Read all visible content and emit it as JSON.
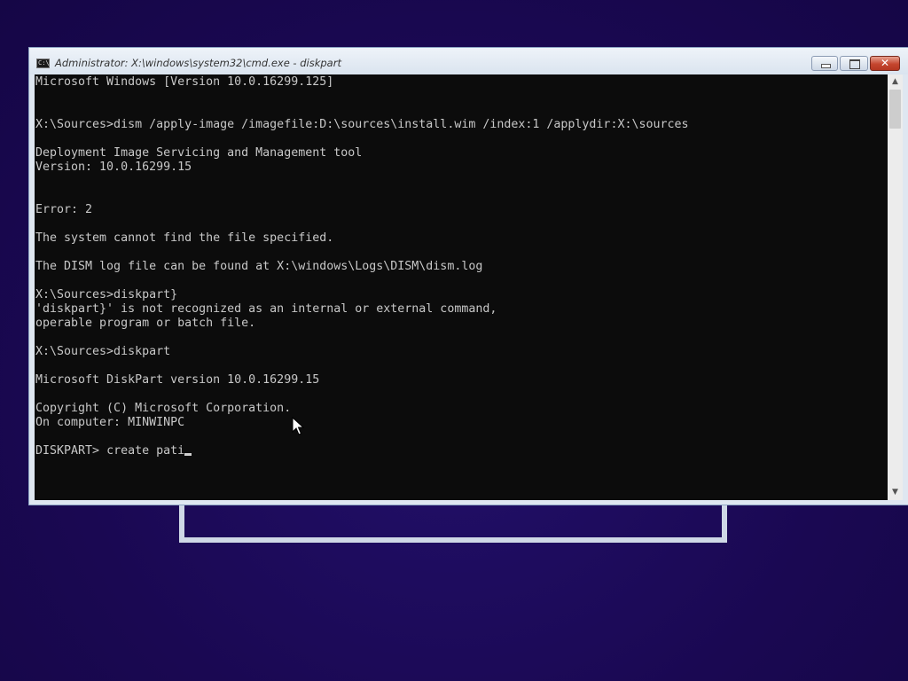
{
  "window": {
    "title": "Administrator: X:\\windows\\system32\\cmd.exe - diskpart",
    "icon": "cmd-icon",
    "icon_glyph": "C:\\",
    "buttons": {
      "minimize_icon": "minimize-icon",
      "maximize_icon": "restore-icon",
      "close_glyph": "✕"
    }
  },
  "console": {
    "lines": [
      "Microsoft Windows [Version 10.0.16299.125]",
      "",
      "",
      "X:\\Sources>dism /apply-image /imagefile:D:\\sources\\install.wim /index:1 /applydir:X:\\sources",
      "",
      "Deployment Image Servicing and Management tool",
      "Version: 10.0.16299.15",
      "",
      "",
      "Error: 2",
      "",
      "The system cannot find the file specified.",
      "",
      "The DISM log file can be found at X:\\windows\\Logs\\DISM\\dism.log",
      "",
      "X:\\Sources>diskpart}",
      "'diskpart}' is not recognized as an internal or external command,",
      "operable program or batch file.",
      "",
      "X:\\Sources>diskpart",
      "",
      "Microsoft DiskPart version 10.0.16299.15",
      "",
      "Copyright (C) Microsoft Corporation.",
      "On computer: MINWINPC",
      ""
    ],
    "prompt": "DISKPART> ",
    "current_input": "create pati"
  },
  "scrollbar": {
    "up_glyph": "▲",
    "down_glyph": "▼"
  },
  "colors": {
    "desktop_background": "#1e0a5c",
    "console_background": "#0c0c0c",
    "console_text": "#c8c8c8",
    "close_button": "#c5462f"
  }
}
